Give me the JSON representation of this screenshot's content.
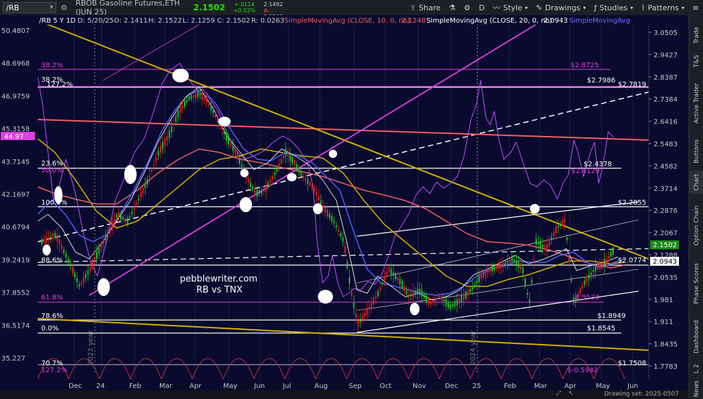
{
  "toolbar": {
    "symbol": "/RB",
    "title": "RBOB Gasoline Futures,ETH (JUN 25)",
    "price": "2.1502",
    "change": "+.0114",
    "change_pct": "+0.53%",
    "bid": "2.1492",
    "ask": "2.1500",
    "buttons": [
      {
        "name": "share",
        "label": "Share"
      },
      {
        "name": "flask",
        "label": ""
      },
      {
        "name": "gear",
        "label": ""
      },
      {
        "name": "d",
        "label": "D"
      },
      {
        "name": "style",
        "label": "Style"
      },
      {
        "name": "drawings",
        "label": "Drawings"
      },
      {
        "name": "studies",
        "label": "Studies"
      },
      {
        "name": "patterns",
        "label": "Patterns"
      }
    ]
  },
  "legend": {
    "symbol": "/RB 5 Y 1D",
    "date": "D: 5/20/25",
    "open": "O: 2.1411",
    "high": "H: 2.1522",
    "low": "L: 2.1259",
    "close": "C: 2.1502",
    "range": "R: 0.0263",
    "sma10": "SimpleMovingAvg (CLOSE, 10, 0, no)",
    "sma10_val": "2.1248",
    "sma20": "SimpleMovingAvg (CLOSE, 20, 0, no)",
    "sma20_val": "2.0943",
    "sma_more": "SimpleMovingAvg"
  },
  "left_axis": [
    "50.4807",
    "48.6968",
    "46.9759",
    "45.3158",
    "43.7145",
    "42.1697",
    "40.6794",
    "39.2419",
    "37.8552",
    "36.5174",
    "35.227"
  ],
  "left_highlight": "44.97",
  "right_axis": [
    "3.0505",
    "2.9427",
    "2.8387",
    "2.7384",
    "2.6416",
    "2.5483",
    "2.4582",
    "2.3714",
    "2.2876",
    "2.2067",
    "2.1288",
    "2.0535",
    "1.981",
    "1.911",
    "1.8435",
    "1.7783"
  ],
  "right_price_tag": "2.1502",
  "right_sma_tag": "2.0943",
  "x_labels": [
    "Dec",
    "24",
    "Feb",
    "Mar",
    "Apr",
    "May",
    "Jun",
    "Jul",
    "Aug",
    "Sep",
    "Oct",
    "Nov",
    "Dec",
    "25",
    "Feb",
    "Mar",
    "Apr",
    "May",
    "Jun"
  ],
  "year_labels": [
    "2023 year",
    "2024 year"
  ],
  "fib_left": [
    "38.2%",
    "23.6%",
    "50.0%",
    "100.0%",
    "88.6%",
    "61.8%",
    "78.6%",
    "0.0%",
    "70.7%",
    "127.2%"
  ],
  "fib_left_top": [
    "38.2%",
    "127.2%"
  ],
  "level_labels": [
    "$2.8725",
    "$2.7986",
    "$2.7819",
    "$2.4378",
    "$2.4129",
    "$2.2855",
    "$2.0774",
    "$.9533",
    "$1.8949",
    "$1.8545",
    "$1.7508",
    "$-0.5942"
  ],
  "watermark": {
    "site": "pebblewriter.com",
    "subtitle": "RB vs TNX"
  },
  "rail_tabs": [
    "Trade",
    "T&S",
    "Active Trader",
    "Buttons",
    "Chart",
    "Option Chain",
    "Phase Scores",
    "Dashboard",
    "L 2",
    "News"
  ],
  "status_text": "Drawing set: 2025-0507",
  "colors": {
    "background": "#0a0a2e",
    "up": "#22c022",
    "down": "#e02020",
    "yellow": "#d4b000",
    "magenta": "#e040e0",
    "salmon": "#f06060",
    "blue": "#5060ff"
  }
}
